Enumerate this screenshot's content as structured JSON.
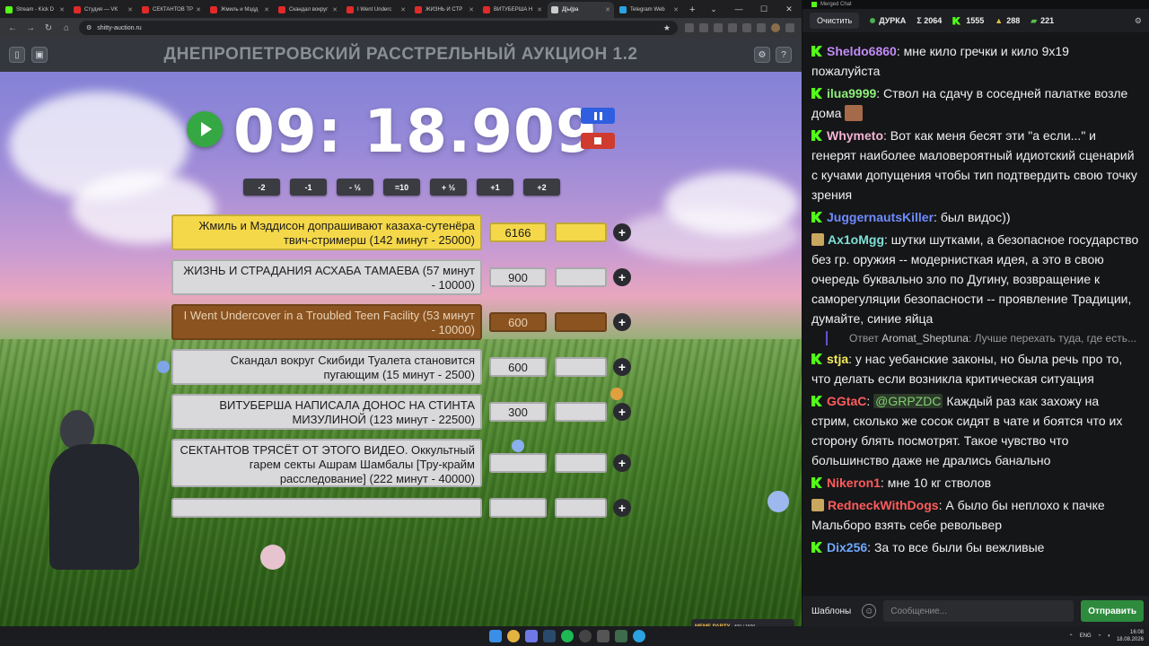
{
  "browser": {
    "tabs": [
      {
        "label": "Stream - Kick D",
        "color": "#53fc18"
      },
      {
        "label": "Студия — VK",
        "color": "#e02a2a"
      },
      {
        "label": "СЕКТАНТОВ ТР",
        "color": "#e02a2a"
      },
      {
        "label": "Жмиль и Мэдд",
        "color": "#e02a2a"
      },
      {
        "label": "Скандал вокруг",
        "color": "#e02a2a"
      },
      {
        "label": "I Went Underc",
        "color": "#e02a2a"
      },
      {
        "label": "ЖИЗНЬ И СТР",
        "color": "#e02a2a"
      },
      {
        "label": "ВИТУБЕРША Н",
        "color": "#e02a2a"
      },
      {
        "label": "Д[ы]ра",
        "color": "#cccccc",
        "active": true
      },
      {
        "label": "Telegram Web",
        "color": "#2aa3e0"
      }
    ],
    "new_tab": "+",
    "url": "shitty-auction.ru"
  },
  "page": {
    "title": "ДНЕПРОПЕТРОВСКИЙ РАССТРЕЛЬНЫЙ АУКЦИОН 1.2",
    "timer": "09: 18.909",
    "steps": [
      "-2",
      "-1",
      "- ½",
      "=10",
      "+ ½",
      "+1",
      "+2"
    ],
    "lots": [
      {
        "title": "Жмиль и Мэддисон допрашивают казаха-сутенёра твич-стримерш (142 минут - 25000)",
        "sum": "6166",
        "style": "yellow"
      },
      {
        "title": "ЖИЗНЬ И СТРАДАНИЯ АСХАБА ТАМАЕВА (57 минут - 10000)",
        "sum": "900",
        "style": "gray"
      },
      {
        "title": "I Went Undercover in a Troubled Teen Facility (53 минут - 10000)",
        "sum": "600",
        "style": "brown"
      },
      {
        "title": "Скандал вокруг Скибиди Туалета становится пугающим (15 минут - 2500)",
        "sum": "600",
        "style": "gray"
      },
      {
        "title": "ВИТУБЕРША НАПИСАЛА ДОНОС НА СТИНТА МИЗУЛИНОЙ (123 минут - 22500)",
        "sum": "300",
        "style": "gray"
      },
      {
        "title": "СЕКТАНТОВ ТРЯСЁТ ОТ ЭТОГО ВИДЕО. Оккультный гарем секты Ашрам Шамбалы [Тру-крайм расследование] (222 минут - 40000)",
        "sum": "",
        "style": "gray"
      },
      {
        "title": "",
        "sum": "",
        "style": "gray"
      }
    ],
    "plus": "+",
    "meme_bar": {
      "label": "MEME PARTY",
      "progress_text": "400 / 1500"
    }
  },
  "chat": {
    "window_title": "Merged Chat",
    "clear": "Очистить",
    "channel": "ДУРКА",
    "total": "Σ 2064",
    "kick_count": "1555",
    "yt_count": "288",
    "tg_count": "221",
    "messages": [
      {
        "user": "Sheldo6860",
        "color": "#c18cf7",
        "badge": "kick",
        "text": "мне кило гречки и кило 9х19 пожалуйста"
      },
      {
        "user": "ilua9999",
        "color": "#8ef07a",
        "badge": "kick",
        "text": "Ствол на сдачу в соседней палатке возле дома"
      },
      {
        "user": "Whymeto",
        "color": "#f3b3d4",
        "badge": "kick",
        "text": "Вот как меня бесят эти \"а если...\" и генерят наиболее маловероятный идиотский сценарий с кучами допущения чтобы тип подтвердить свою точку зрения"
      },
      {
        "user": "JuggernautsKiller",
        "color": "#6e8cff",
        "badge": "kick",
        "text": "был видос))"
      },
      {
        "user": "Ax1oMgg",
        "color": "#7ee0d6",
        "badge": "tg",
        "text": "шутки шутками, а безопасное государство без гр. оружия -- модернисткая идея, а это в свою очередь буквально зло по Дугину, возвращение к саморегуляции безопасности -- проявление Традиции, думайте, синие яйца"
      },
      {
        "user": "stja",
        "color": "#f4ea5a",
        "badge": "kick",
        "text": "у нас уебанские законы, но была речь про то, что делать если возникла критическая ситуация"
      },
      {
        "user": "GGtaC",
        "color": "#ff5c5c",
        "badge": "kick",
        "text": "Каждый раз как захожу на стрим, сколько же сосок сидят в чате и боятся что их сторону блять посмотрят. Такое чувство что большинство даже не дрались банально"
      },
      {
        "user": "Nikeron1",
        "color": "#ff5c5c",
        "badge": "kick",
        "text": "мне 10 кг стволов"
      },
      {
        "user": "RedneckWithDogs",
        "color": "#ff5c5c",
        "badge": "tg",
        "text": "А было бы неплохо к пачке Мальборо взять себе револьвер"
      },
      {
        "user": "Dix256",
        "color": "#6fa8ff",
        "badge": "kick",
        "text": "За то все были бы вежливые"
      }
    ],
    "reply": {
      "prefix": "Ответ",
      "user": "Aromat_Sheptuna",
      "text": "Лучше перехать туда, где есть..."
    },
    "mention": "@GRPZDC",
    "templates": "Шаблоны",
    "placeholder": "Сообщение...",
    "send": "Отправить"
  },
  "taskbar": {
    "lang": "ENG",
    "time": "16:08",
    "date": "18.08.2026"
  }
}
